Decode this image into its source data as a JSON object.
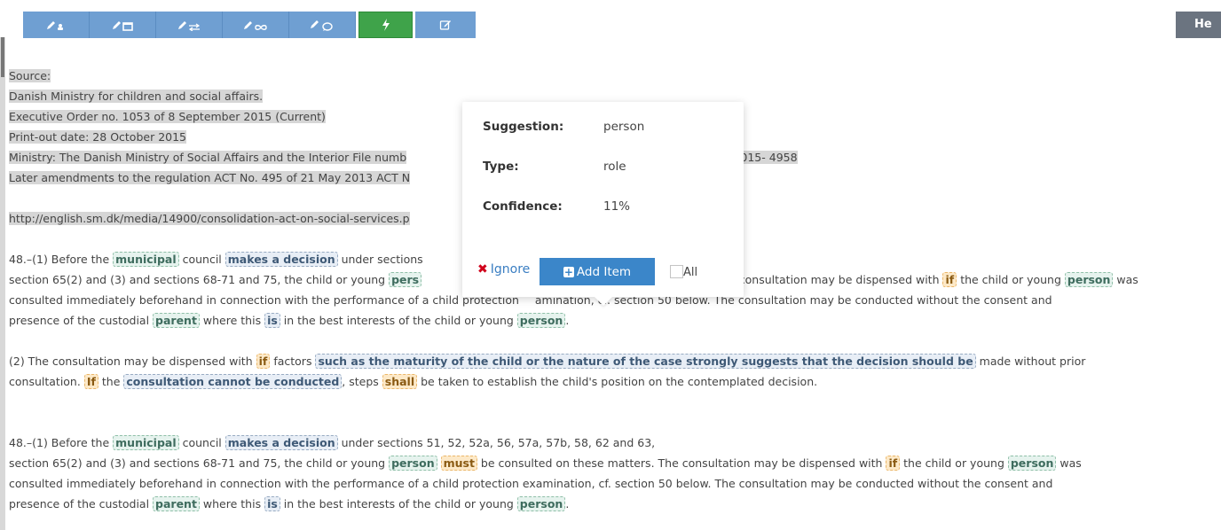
{
  "toolbar": {
    "buttons": [
      {
        "icon": "pencil-person-icon",
        "active": false
      },
      {
        "icon": "pencil-window-icon",
        "active": false
      },
      {
        "icon": "pencil-exchange-icon",
        "active": false
      },
      {
        "icon": "pencil-infinity-icon",
        "active": false
      },
      {
        "icon": "pencil-comment-icon",
        "active": false
      },
      {
        "icon": "bolt-icon",
        "active": true
      },
      {
        "icon": "edit-icon",
        "active": false
      }
    ],
    "help_label": "He"
  },
  "colors": {
    "toolbar": "#6f9fd2",
    "active": "#3fa34a",
    "primary": "#3b86c9",
    "highlight": "#d6d6d6"
  },
  "doc": {
    "source_label": "Source:",
    "ministry": "Danish Ministry for children and social affairs.",
    "order": "Executive Order no. 1053 of 8 September 2015 (Current)",
    "printout": "Print-out date: 28 October 2015",
    "ministry_line_a": "Ministry: The Danish Ministry of Social Affairs and the Interior File numb",
    "ministry_line_b": "file no. 2015- 4958",
    "amendments": "Later amendments to the regulation ACT No. 495 of 21 May 2013 ACT N",
    "url": "http://english.sm.dk/media/14900/consolidation-act-on-social-services.p",
    "p1": {
      "a": "48.–(1) Before the ",
      "t_municipal": "municipal",
      "b": " council ",
      "t_makes": "makes a decision",
      "c": " under sections ",
      "d": "section 65(2) and (3) and sections 68-71 and 75, the child or young ",
      "t_person_trunc": "pers",
      "e": "e consultation may be dispensed with ",
      "t_if": "if",
      "f": " the child or young ",
      "t_person": "person",
      "g": " was",
      "h": "consulted immediately beforehand in connection with the performance of a child protection ",
      "h2": "amination, cf. section 50 below. The consultation may be conducted without the consent and",
      "i": "presence of the custodial ",
      "t_parent": "parent",
      "j": " where this ",
      "t_is": "is",
      "k": " in the best interests of the child or young ",
      "l": "."
    },
    "p2": {
      "a": "(2) The consultation may be dispensed with ",
      "t_if": "if",
      "b": " factors ",
      "t_such": "such as the maturity of the child or the nature of the case strongly suggests that the decision should be",
      "c": " made without prior",
      "d": "consultation. ",
      "t_If": "If",
      "e": " the ",
      "t_consult": "consultation cannot be conducted",
      "f": ", steps ",
      "t_shall": "shall",
      "g": " be taken to establish the child's position on the contemplated decision."
    },
    "p3": {
      "a": "48.–(1) Before the ",
      "t_municipal": "municipal",
      "b": " council ",
      "t_makes": "makes a decision",
      "c": " under sections 51, 52, 52a, 56, 57a, 57b, 58, 62 and 63,",
      "d": "section 65(2) and (3) and sections 68-71 and 75, the child or young ",
      "t_person": "person",
      "t_must": "must",
      "e": " be consulted on these matters. The consultation may be dispensed with ",
      "t_if": "if",
      "f": " the child or young ",
      "g": " was",
      "h": "consulted immediately beforehand in connection with the performance of a child protection examination, cf. section 50 below. The consultation may be conducted without the consent and",
      "i": "presence of the custodial ",
      "t_parent": "parent",
      "j": " where this ",
      "t_is": "is",
      "k": " in the best interests of the child or young ",
      "l": "."
    }
  },
  "popup": {
    "suggestion_label": "Suggestion:",
    "suggestion_value": "person",
    "type_label": "Type:",
    "type_value": "role",
    "confidence_label": "Confidence:",
    "confidence_value": "11%",
    "ignore_label": "Ignore",
    "add_label": "Add Item",
    "all_label": "All"
  }
}
